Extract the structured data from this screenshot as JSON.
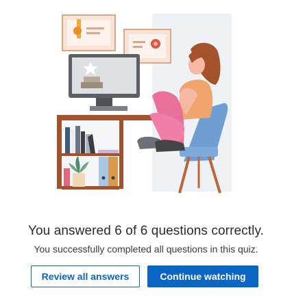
{
  "result": {
    "title": "You answered 6 of 6 questions correctly.",
    "subtitle": "You successfully completed all questions in this quiz."
  },
  "actions": {
    "review_label": "Review all answers",
    "continue_label": "Continue watching"
  },
  "colors": {
    "primary": "#0a66c2",
    "background": "#ffffff"
  }
}
